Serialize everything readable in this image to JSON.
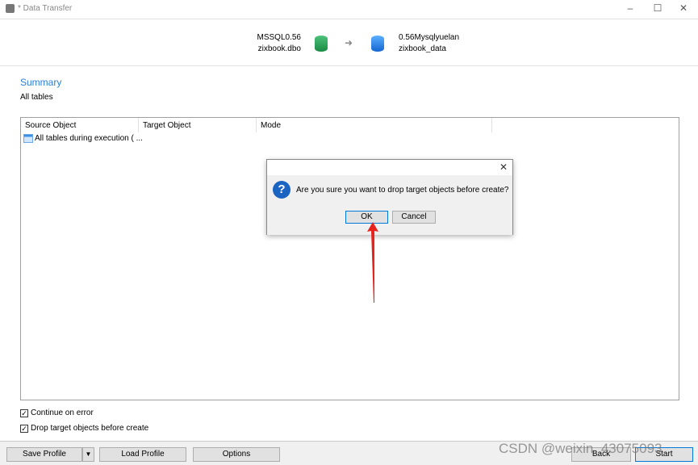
{
  "window": {
    "title": "* Data Transfer",
    "minimize": "–",
    "maximize": "☐",
    "close": "✕"
  },
  "source": {
    "connection": "MSSQL0.56",
    "schema": "zixbook.dbo",
    "color": "#1e9e4e"
  },
  "target": {
    "connection": "0.56Mysqlyuelan",
    "schema": "zixbook_data",
    "color": "#1e7fe0"
  },
  "arrow": "➜",
  "summary": {
    "title": "Summary",
    "subtitle": "All tables"
  },
  "grid": {
    "columns": [
      "Source Object",
      "Target Object",
      "Mode"
    ],
    "rows": [
      {
        "source": "All tables during execution ( ..."
      }
    ]
  },
  "options": [
    {
      "label": "Continue on error",
      "checked": true
    },
    {
      "label": "Drop target objects before create",
      "checked": true
    }
  ],
  "footer": {
    "save_profile": "Save Profile",
    "load_profile": "Load Profile",
    "options": "Options",
    "back": "Back",
    "start": "Start"
  },
  "dialog": {
    "message": "Are you sure you want to drop target objects before create?",
    "ok": "OK",
    "cancel": "Cancel",
    "close": "✕",
    "icon": "?"
  },
  "watermark": "CSDN @weixin_43075093"
}
